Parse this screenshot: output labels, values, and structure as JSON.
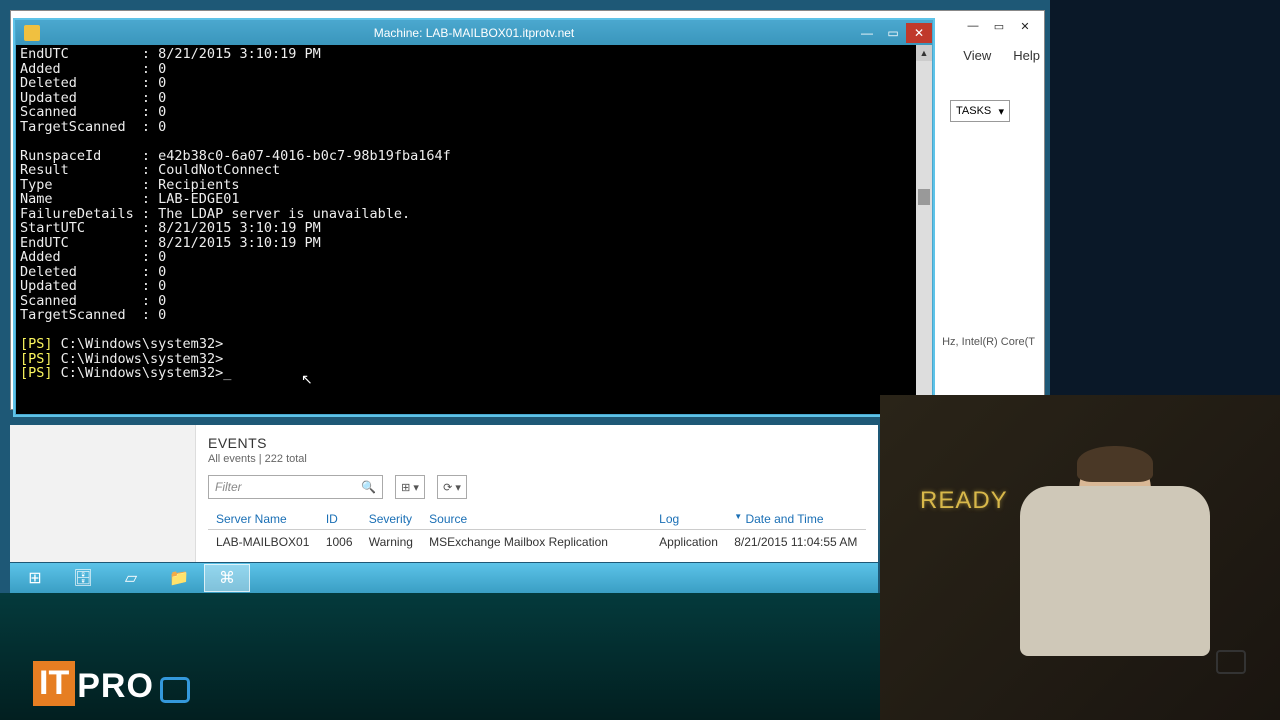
{
  "bg_window": {
    "menu": {
      "view": "View",
      "help": "Help"
    },
    "tasks_label": "TASKS",
    "cpu_label": "Hz, Intel(R) Core(T"
  },
  "terminal": {
    "title": "Machine: LAB-MAILBOX01.itprotv.net",
    "output_block": "EndUTC         : 8/21/2015 3:10:19 PM\nAdded          : 0\nDeleted        : 0\nUpdated        : 0\nScanned        : 0\nTargetScanned  : 0\n\nRunspaceId     : e42b38c0-6a07-4016-b0c7-98b19fba164f\nResult         : CouldNotConnect\nType           : Recipients\nName           : LAB-EDGE01\nFailureDetails : The LDAP server is unavailable.\nStartUTC       : 8/21/2015 3:10:19 PM\nEndUTC         : 8/21/2015 3:10:19 PM\nAdded          : 0\nDeleted        : 0\nUpdated        : 0\nScanned        : 0\nTargetScanned  : 0\n\n",
    "prompt_prefix": "[PS]",
    "prompt_path": " C:\\Windows\\system32>"
  },
  "events": {
    "title": "EVENTS",
    "subtitle": "All events | 222 total",
    "filter_placeholder": "Filter",
    "columns": {
      "server": "Server Name",
      "id": "ID",
      "severity": "Severity",
      "source": "Source",
      "log": "Log",
      "date": "Date and Time"
    },
    "row": {
      "server": "LAB-MAILBOX01",
      "id": "1006",
      "severity": "Warning",
      "source": "MSExchange Mailbox Replication",
      "log": "Application",
      "date": "8/21/2015 11:04:55 AM"
    }
  },
  "video": {
    "ready": "READY"
  },
  "icons": {
    "min": "—",
    "max": "▭",
    "close": "✕",
    "tri": "▾",
    "up": "▲",
    "down": "▼",
    "search": "🔍",
    "grid": "⊞"
  }
}
